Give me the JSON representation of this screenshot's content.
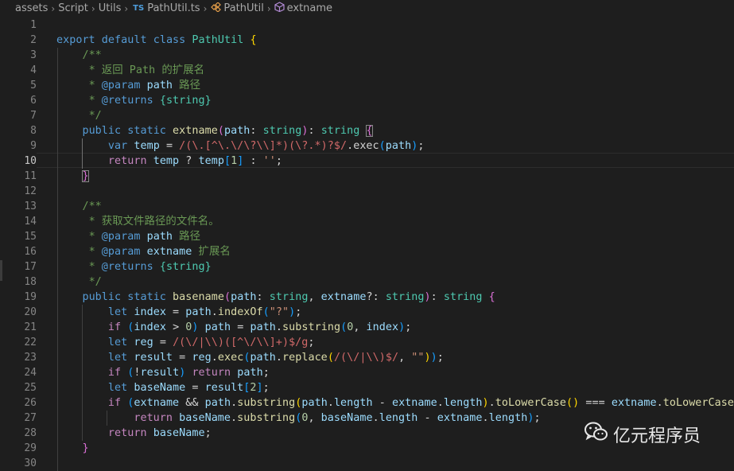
{
  "breadcrumb": {
    "items": [
      "assets",
      "Script",
      "Utils",
      "PathUtil.ts",
      "PathUtil",
      "extname"
    ],
    "ts_badge": "TS"
  },
  "editor": {
    "active_line": 10,
    "line_numbers": [
      "1",
      "2",
      "3",
      "4",
      "5",
      "6",
      "7",
      "8",
      "9",
      "10",
      "11",
      "12",
      "13",
      "14",
      "15",
      "16",
      "17",
      "18",
      "19",
      "20",
      "21",
      "22",
      "23",
      "24",
      "25",
      "26",
      "27",
      "28",
      "29",
      "30"
    ],
    "lines": [
      [],
      [
        [
          "kw",
          "export"
        ],
        [
          "",
          "&nbsp;"
        ],
        [
          "kw",
          "default"
        ],
        [
          "",
          "&nbsp;"
        ],
        [
          "kw",
          "class"
        ],
        [
          "",
          "&nbsp;"
        ],
        [
          "type",
          "PathUtil"
        ],
        [
          "",
          "&nbsp;"
        ],
        [
          "br1",
          "{"
        ]
      ],
      [
        [
          "",
          "    "
        ],
        [
          "cm",
          "/**"
        ]
      ],
      [
        [
          "",
          "    "
        ],
        [
          "cm",
          " * 返回 Path 的扩展名"
        ]
      ],
      [
        [
          "",
          "    "
        ],
        [
          "cm",
          " * "
        ],
        [
          "kw",
          "@param"
        ],
        [
          "",
          "&nbsp;"
        ],
        [
          "var",
          "path"
        ],
        [
          "cm",
          " 路径"
        ]
      ],
      [
        [
          "",
          "    "
        ],
        [
          "cm",
          " * "
        ],
        [
          "kw",
          "@returns"
        ],
        [
          "",
          "&nbsp;"
        ],
        [
          "type",
          "{string}"
        ]
      ],
      [
        [
          "",
          "    "
        ],
        [
          "cm",
          " */"
        ]
      ],
      [
        [
          "",
          "    "
        ],
        [
          "kw",
          "public"
        ],
        [
          "",
          "&nbsp;"
        ],
        [
          "kw",
          "static"
        ],
        [
          "",
          "&nbsp;"
        ],
        [
          "fn",
          "extname"
        ],
        [
          "br2",
          "("
        ],
        [
          "var",
          "path"
        ],
        [
          "",
          ": "
        ],
        [
          "type",
          "string"
        ],
        [
          "br2",
          ")"
        ],
        [
          "",
          ": "
        ],
        [
          "type",
          "string"
        ],
        [
          "",
          "&nbsp;"
        ],
        [
          "br2 bracket-box",
          "{"
        ]
      ],
      [
        [
          "",
          "        "
        ],
        [
          "kw",
          "var"
        ],
        [
          "",
          "&nbsp;"
        ],
        [
          "var",
          "temp"
        ],
        [
          "",
          ""
        ],
        [
          "",
          ""
        ],
        [
          "",
          ""
        ],
        [
          "",
          ""
        ],
        [
          "",
          ""
        ],
        [
          "",
          ""
        ],
        [
          "",
          ""
        ],
        [
          "",
          ""
        ],
        [
          "",
          ""
        ],
        [
          "",
          ""
        ],
        [
          "",
          ""
        ],
        [
          "",
          ""
        ],
        [
          "",
          "&nbsp;= "
        ],
        [
          "re",
          "/(\\.[^\\.\\/\\?\\\\]*)(\\?.*)?$/"
        ],
        [
          "",
          ".exec"
        ],
        [
          "br3",
          "("
        ],
        [
          "var",
          "path"
        ],
        [
          "br3",
          ")"
        ],
        [
          "",
          ";"
        ]
      ],
      [
        [
          "",
          "        "
        ],
        [
          "ctl",
          "return"
        ],
        [
          "",
          "&nbsp;"
        ],
        [
          "var",
          "temp"
        ],
        [
          "",
          ""
        ],
        [
          "",
          ""
        ],
        [
          "",
          ""
        ],
        [
          "",
          ""
        ],
        [
          "",
          ""
        ],
        [
          "",
          ""
        ],
        [
          "",
          ""
        ],
        [
          "",
          ""
        ],
        [
          "",
          ""
        ],
        [
          "",
          ""
        ],
        [
          "",
          ""
        ],
        [
          "",
          ""
        ],
        [
          "",
          "&nbsp;? "
        ],
        [
          "var",
          "temp"
        ],
        [
          "br3",
          "["
        ],
        [
          "num",
          "1"
        ],
        [
          "br3",
          "]"
        ],
        [
          "",
          "&nbsp;: "
        ],
        [
          "str",
          "''"
        ],
        [
          "",
          ";"
        ]
      ],
      [
        [
          "",
          "    "
        ],
        [
          "br2 bracket-box",
          "}"
        ]
      ],
      [],
      [
        [
          "",
          "    "
        ],
        [
          "cm",
          "/**"
        ]
      ],
      [
        [
          "",
          "    "
        ],
        [
          "cm",
          " * 获取文件路径的文件名。"
        ]
      ],
      [
        [
          "",
          "    "
        ],
        [
          "cm",
          " * "
        ],
        [
          "kw",
          "@param"
        ],
        [
          "",
          "&nbsp;"
        ],
        [
          "var",
          "path"
        ],
        [
          "cm",
          " 路径"
        ]
      ],
      [
        [
          "",
          "    "
        ],
        [
          "cm",
          " * "
        ],
        [
          "kw",
          "@param"
        ],
        [
          "",
          "&nbsp;"
        ],
        [
          "var",
          "extname"
        ],
        [
          "cm",
          " 扩展名"
        ]
      ],
      [
        [
          "",
          "    "
        ],
        [
          "cm",
          " * "
        ],
        [
          "kw",
          "@returns"
        ],
        [
          "",
          "&nbsp;"
        ],
        [
          "type",
          "{string}"
        ]
      ],
      [
        [
          "",
          "    "
        ],
        [
          "cm",
          " */"
        ]
      ],
      [
        [
          "",
          "    "
        ],
        [
          "kw",
          "public"
        ],
        [
          "",
          "&nbsp;"
        ],
        [
          "kw",
          "static"
        ],
        [
          "",
          "&nbsp;"
        ],
        [
          "fn",
          "basename"
        ],
        [
          "br2",
          "("
        ],
        [
          "var",
          "path"
        ],
        [
          "",
          ": "
        ],
        [
          "type",
          "string"
        ],
        [
          "",
          ", "
        ],
        [
          "var",
          "extname"
        ],
        [
          "",
          "?: "
        ],
        [
          "type",
          "string"
        ],
        [
          "br2",
          ")"
        ],
        [
          "",
          ": "
        ],
        [
          "type",
          "string"
        ],
        [
          "",
          "&nbsp;"
        ],
        [
          "br2",
          "{"
        ]
      ],
      [
        [
          "",
          "        "
        ],
        [
          "kw",
          "let"
        ],
        [
          "",
          "&nbsp;"
        ],
        [
          "var",
          "index"
        ],
        [
          "",
          "&nbsp;= "
        ],
        [
          "var",
          "path"
        ],
        [
          "",
          "."
        ],
        [
          "fn",
          "indexOf"
        ],
        [
          "br3",
          "("
        ],
        [
          "str",
          "\"?\""
        ],
        [
          "br3",
          ")"
        ],
        [
          "",
          ";"
        ]
      ],
      [
        [
          "",
          "        "
        ],
        [
          "ctl",
          "if"
        ],
        [
          "",
          "&nbsp;"
        ],
        [
          "br3",
          "("
        ],
        [
          "var",
          "index"
        ],
        [
          "",
          "&nbsp;> "
        ],
        [
          "num",
          "0"
        ],
        [
          "br3",
          ")"
        ],
        [
          "",
          "&nbsp;"
        ],
        [
          "var",
          "path"
        ],
        [
          "",
          "&nbsp;= "
        ],
        [
          "var",
          "path"
        ],
        [
          "",
          "."
        ],
        [
          "fn",
          "substring"
        ],
        [
          "br3",
          "("
        ],
        [
          "num",
          "0"
        ],
        [
          "",
          ", "
        ],
        [
          "var",
          "index"
        ],
        [
          "br3",
          ")"
        ],
        [
          "",
          ";"
        ]
      ],
      [
        [
          "",
          "        "
        ],
        [
          "kw",
          "let"
        ],
        [
          "",
          "&nbsp;"
        ],
        [
          "var",
          "reg"
        ],
        [
          "",
          "&nbsp;= "
        ],
        [
          "re",
          "/(\\/|\\\\)([^\\/\\\\]+)$/g"
        ],
        [
          "",
          ";"
        ]
      ],
      [
        [
          "",
          "        "
        ],
        [
          "kw",
          "let"
        ],
        [
          "",
          "&nbsp;"
        ],
        [
          "var",
          "result"
        ],
        [
          "",
          "&nbsp;= "
        ],
        [
          "var",
          "reg"
        ],
        [
          "",
          "."
        ],
        [
          "fn",
          "exec"
        ],
        [
          "br3",
          "("
        ],
        [
          "var",
          "path"
        ],
        [
          "",
          "."
        ],
        [
          "fn",
          "replace"
        ],
        [
          "br1",
          "("
        ],
        [
          "re",
          "/(\\/|\\\\)$/"
        ],
        [
          "",
          ", "
        ],
        [
          "str",
          "\"\""
        ],
        [
          "br1",
          ")"
        ],
        [
          "br3",
          ")"
        ],
        [
          "",
          ";"
        ]
      ],
      [
        [
          "",
          "        "
        ],
        [
          "ctl",
          "if"
        ],
        [
          "",
          "&nbsp;"
        ],
        [
          "br3",
          "("
        ],
        [
          "",
          "!"
        ],
        [
          "var",
          "result"
        ],
        [
          "br3",
          ")"
        ],
        [
          "",
          "&nbsp;"
        ],
        [
          "ctl",
          "return"
        ],
        [
          "",
          "&nbsp;"
        ],
        [
          "var",
          "path"
        ],
        [
          "",
          ";"
        ]
      ],
      [
        [
          "",
          "        "
        ],
        [
          "kw",
          "let"
        ],
        [
          "",
          "&nbsp;"
        ],
        [
          "var",
          "baseName"
        ],
        [
          "",
          "&nbsp;= "
        ],
        [
          "var",
          "result"
        ],
        [
          "br3",
          "["
        ],
        [
          "num",
          "2"
        ],
        [
          "br3",
          "]"
        ],
        [
          "",
          ";"
        ]
      ],
      [
        [
          "",
          "        "
        ],
        [
          "ctl",
          "if"
        ],
        [
          "",
          "&nbsp;"
        ],
        [
          "br3",
          "("
        ],
        [
          "var",
          "extname"
        ],
        [
          "",
          "&nbsp;&& "
        ],
        [
          "var",
          "path"
        ],
        [
          "",
          "."
        ],
        [
          "fn",
          "substring"
        ],
        [
          "br1",
          "("
        ],
        [
          "var",
          "path"
        ],
        [
          "",
          "."
        ],
        [
          "var",
          "length"
        ],
        [
          "",
          "&nbsp;- "
        ],
        [
          "var",
          "extname"
        ],
        [
          "",
          "."
        ],
        [
          "var",
          "length"
        ],
        [
          "br1",
          ")"
        ],
        [
          "",
          "."
        ],
        [
          "fn",
          "toLowerCase"
        ],
        [
          "br1",
          "()"
        ],
        [
          "",
          "&nbsp;=== "
        ],
        [
          "var",
          "extname"
        ],
        [
          "",
          "."
        ],
        [
          "fn",
          "toLowerCase"
        ],
        [
          "br1",
          "()"
        ],
        [
          "br3",
          ")"
        ]
      ],
      [
        [
          "",
          "            "
        ],
        [
          "ctl",
          "return"
        ],
        [
          "",
          "&nbsp;"
        ],
        [
          "var",
          "baseName"
        ],
        [
          "",
          "."
        ],
        [
          "fn",
          "substring"
        ],
        [
          "br3",
          "("
        ],
        [
          "num",
          "0"
        ],
        [
          "",
          ", "
        ],
        [
          "var",
          "baseName"
        ],
        [
          "",
          "."
        ],
        [
          "var",
          "length"
        ],
        [
          "",
          "&nbsp;- "
        ],
        [
          "var",
          "extname"
        ],
        [
          "",
          "."
        ],
        [
          "var",
          "length"
        ],
        [
          "br3",
          ")"
        ],
        [
          "",
          ";"
        ]
      ],
      [
        [
          "",
          "        "
        ],
        [
          "ctl",
          "return"
        ],
        [
          "",
          "&nbsp;"
        ],
        [
          "var",
          "baseName"
        ],
        [
          "",
          ";"
        ]
      ],
      [
        [
          "",
          "    "
        ],
        [
          "br2",
          "}"
        ]
      ],
      []
    ]
  },
  "watermark": {
    "text": "亿元程序员"
  }
}
